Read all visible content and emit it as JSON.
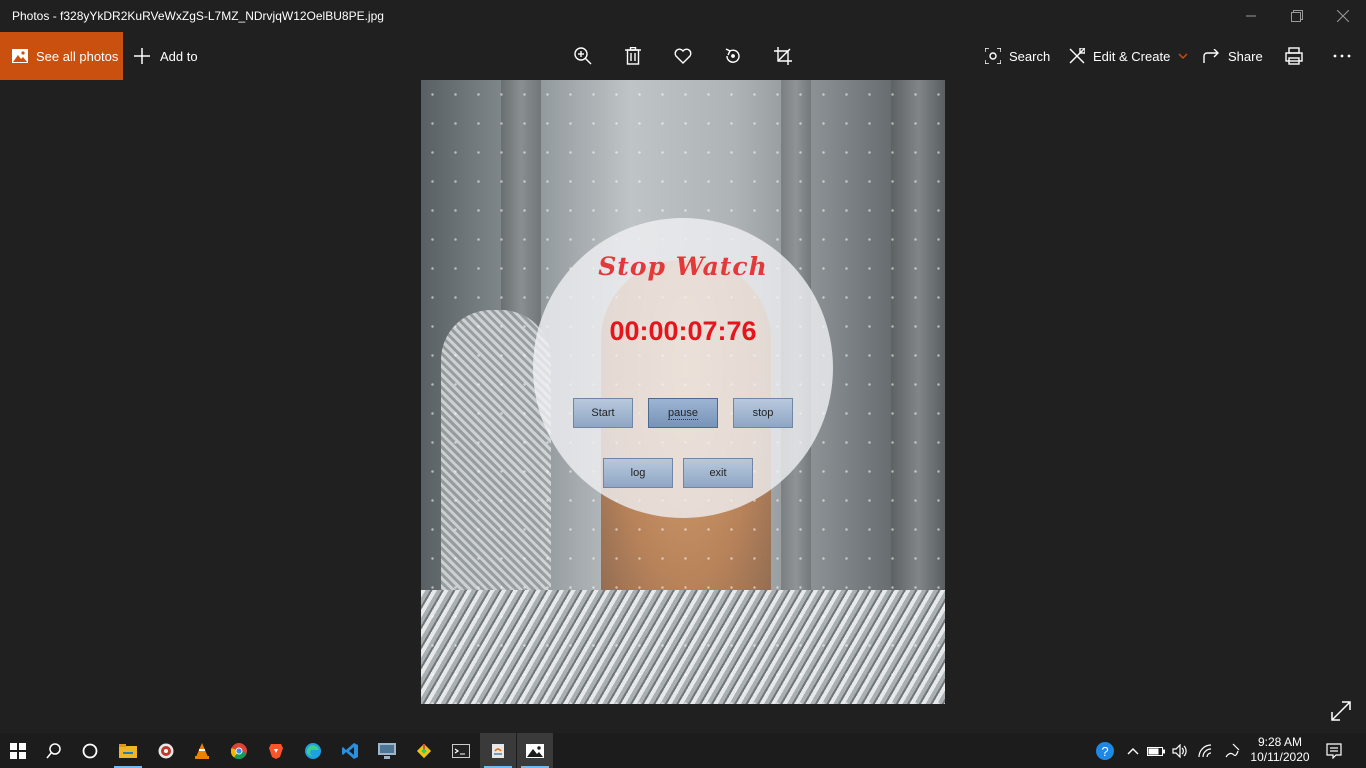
{
  "window": {
    "title": "Photos - f328yYkDR2KuRVeWxZgS-L7MZ_NDrvjqW12OelBU8PE.jpg"
  },
  "toolbar": {
    "see_all_label": "See all photos",
    "add_to_label": "Add to",
    "search_label": "Search",
    "edit_create_label": "Edit & Create",
    "share_label": "Share",
    "accent": "#ca5010"
  },
  "stopwatch": {
    "title": "Stop Watch",
    "time": "00:00:07:76",
    "buttons": {
      "start": "Start",
      "pause": "pause",
      "stop": "stop",
      "log": "log",
      "exit": "exit"
    },
    "title_color": "#e23a3a",
    "time_color": "#e8141c"
  },
  "taskbar": {
    "time": "9:28 AM",
    "date": "10/11/2020",
    "apps": [
      "start-icon",
      "search-icon",
      "cortana-icon",
      "file-explorer-icon",
      "media-app-icon",
      "vlc-icon",
      "chrome-icon",
      "brave-icon",
      "edge-icon",
      "vscode-icon",
      "remote-desktop-icon",
      "git-icon",
      "terminal-icon",
      "java-app-icon",
      "photos-icon"
    ]
  }
}
